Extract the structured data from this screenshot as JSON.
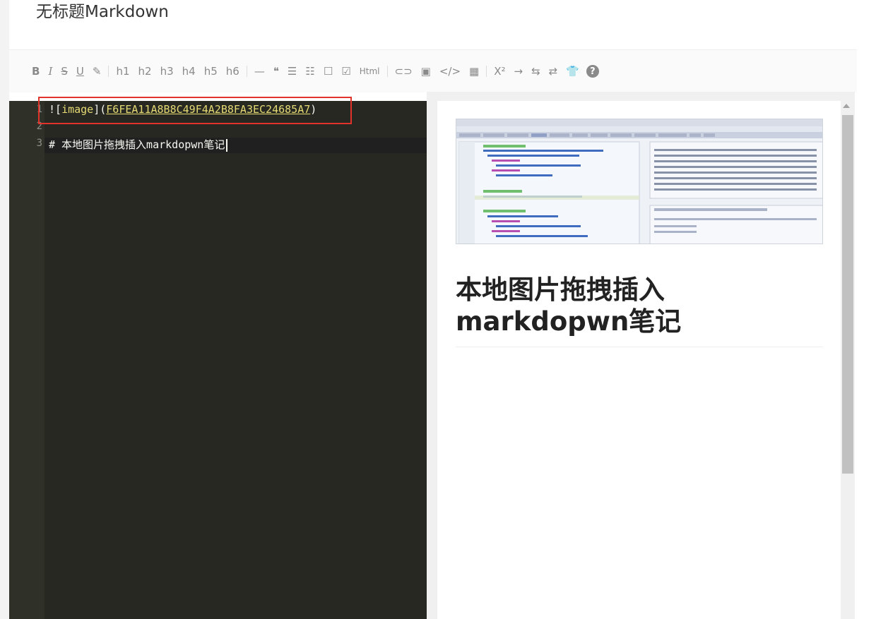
{
  "document": {
    "title": "无标题Markdown"
  },
  "toolbar": {
    "buttons": [
      {
        "name": "bold-button",
        "glyph": "B",
        "kind": "text",
        "bold": true
      },
      {
        "name": "italic-button",
        "glyph": "I",
        "kind": "text",
        "italic": true
      },
      {
        "name": "strikethrough-button",
        "glyph": "S",
        "kind": "text",
        "strike": true
      },
      {
        "name": "underline-button",
        "glyph": "U",
        "kind": "text",
        "underline": true
      },
      {
        "name": "highlight-button",
        "glyph": "✎",
        "kind": "icon",
        "icon": "highlighter-icon"
      },
      {
        "sep": true
      },
      {
        "name": "h1-button",
        "glyph": "h1",
        "kind": "text"
      },
      {
        "name": "h2-button",
        "glyph": "h2",
        "kind": "text"
      },
      {
        "name": "h3-button",
        "glyph": "h3",
        "kind": "text"
      },
      {
        "name": "h4-button",
        "glyph": "h4",
        "kind": "text"
      },
      {
        "name": "h5-button",
        "glyph": "h5",
        "kind": "text"
      },
      {
        "name": "h6-button",
        "glyph": "h6",
        "kind": "text"
      },
      {
        "sep": true
      },
      {
        "name": "horizontal-rule-button",
        "glyph": "—",
        "kind": "icon",
        "icon": "hr-icon"
      },
      {
        "name": "quote-button",
        "glyph": "❝",
        "kind": "icon",
        "icon": "quote-icon"
      },
      {
        "name": "unordered-list-button",
        "glyph": "☰",
        "kind": "icon",
        "icon": "list-ul-icon"
      },
      {
        "name": "ordered-list-button",
        "glyph": "☷",
        "kind": "icon",
        "icon": "list-ol-icon"
      },
      {
        "name": "checkbox-button",
        "glyph": "☐",
        "kind": "icon",
        "icon": "square-icon"
      },
      {
        "name": "checked-box-button",
        "glyph": "☑",
        "kind": "icon",
        "icon": "check-square-icon"
      },
      {
        "name": "html-button",
        "glyph": "Html",
        "kind": "text",
        "small": true
      },
      {
        "sep": true
      },
      {
        "name": "link-button",
        "glyph": "⊂⊃",
        "kind": "icon",
        "icon": "link-icon"
      },
      {
        "name": "image-button",
        "glyph": "▣",
        "kind": "icon",
        "icon": "image-icon"
      },
      {
        "name": "code-button",
        "glyph": "</>",
        "kind": "icon",
        "icon": "code-icon"
      },
      {
        "name": "table-button",
        "glyph": "▦",
        "kind": "icon",
        "icon": "table-icon"
      },
      {
        "sep": true
      },
      {
        "name": "superscript-button",
        "glyph": "X²",
        "kind": "text"
      },
      {
        "name": "arrow-right-button",
        "glyph": "→",
        "kind": "icon",
        "icon": "arrow-right-icon"
      },
      {
        "name": "swap-button",
        "glyph": "⇆",
        "kind": "icon",
        "icon": "swap-icon"
      },
      {
        "name": "align-button",
        "glyph": "⇄",
        "kind": "icon",
        "icon": "align-icon"
      },
      {
        "name": "theme-button",
        "glyph": "👕",
        "kind": "icon",
        "icon": "shirt-icon"
      },
      {
        "name": "help-button",
        "glyph": "?",
        "kind": "icon",
        "icon": "help-circle-icon"
      }
    ]
  },
  "editor": {
    "line_numbers": [
      "1",
      "2",
      "3"
    ],
    "line1": {
      "prefix": "![",
      "alt": "image",
      "mid": "](",
      "url": "F6FEA11A8B8C49F4A2B8FA3EC24685A7",
      "suffix": ")"
    },
    "line3": "# 本地图片拖拽插入markdopwn笔记"
  },
  "preview": {
    "heading": "本地图片拖拽插入markdopwn笔记",
    "image_icon": "embedded-sap-debugger-screenshot"
  },
  "colors": {
    "editor_bg": "#272822",
    "highlight_box": "#e0332b",
    "string": "#e6db74"
  }
}
